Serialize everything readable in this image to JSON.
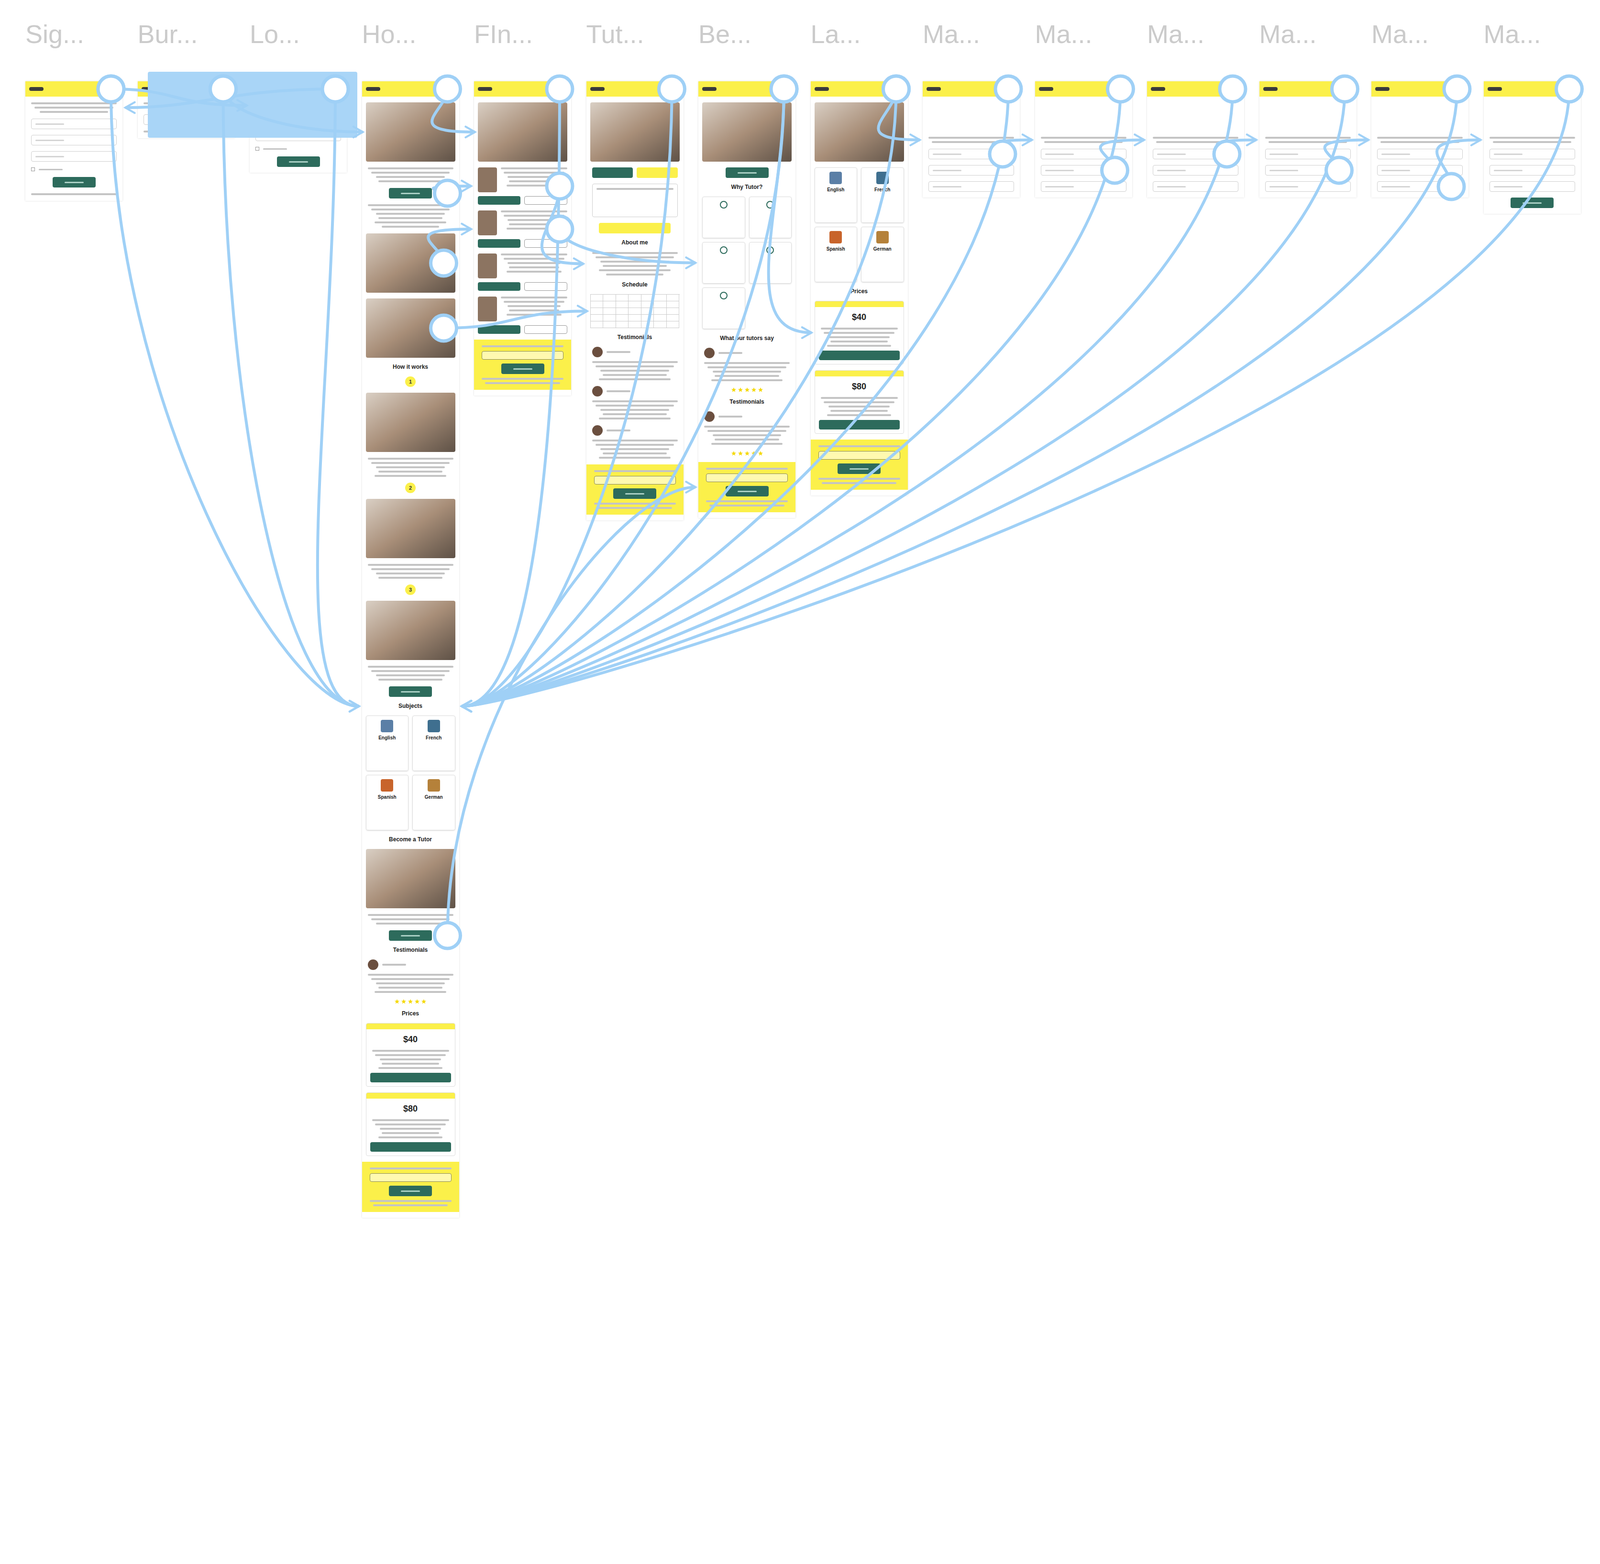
{
  "frames": [
    {
      "title": "Sig...",
      "sections": [
        {
          "kind": "header"
        },
        {
          "kind": "text",
          "lines": 3
        },
        {
          "kind": "field"
        },
        {
          "kind": "field"
        },
        {
          "kind": "field"
        },
        {
          "kind": "check"
        },
        {
          "kind": "button"
        },
        {
          "kind": "text",
          "lines": 1
        }
      ]
    },
    {
      "title": "Bur...",
      "sections": [
        {
          "kind": "header"
        },
        {
          "kind": "text",
          "lines": 2
        },
        {
          "kind": "field"
        },
        {
          "kind": "text",
          "lines": 1
        }
      ]
    },
    {
      "title": "Lo...",
      "sections": [
        {
          "kind": "header"
        },
        {
          "kind": "text",
          "lines": 2
        },
        {
          "kind": "field"
        },
        {
          "kind": "field"
        },
        {
          "kind": "check"
        },
        {
          "kind": "button"
        }
      ]
    },
    {
      "title": "Ho...",
      "sections": [
        {
          "kind": "header"
        },
        {
          "kind": "image"
        },
        {
          "kind": "text",
          "lines": 4
        },
        {
          "kind": "button"
        },
        {
          "kind": "text",
          "lines": 6
        },
        {
          "kind": "image"
        },
        {
          "kind": "image"
        },
        {
          "kind": "heading",
          "text": "How it works"
        },
        {
          "kind": "step",
          "text": "1"
        },
        {
          "kind": "image"
        },
        {
          "kind": "text",
          "lines": 5
        },
        {
          "kind": "step",
          "text": "2"
        },
        {
          "kind": "image"
        },
        {
          "kind": "text",
          "lines": 4
        },
        {
          "kind": "step",
          "text": "3"
        },
        {
          "kind": "image"
        },
        {
          "kind": "text",
          "lines": 4
        },
        {
          "kind": "button"
        },
        {
          "kind": "heading",
          "text": "Subjects"
        },
        {
          "kind": "cards",
          "items": [
            {
              "text": "English",
              "color": "#5b7fa6"
            },
            {
              "text": "French",
              "color": "#3f6f8f"
            },
            {
              "text": "Spanish",
              "color": "#c8642b"
            },
            {
              "text": "German",
              "color": "#b5813a"
            }
          ]
        },
        {
          "kind": "heading",
          "text": "Become a Tutor"
        },
        {
          "kind": "image"
        },
        {
          "kind": "text",
          "lines": 3
        },
        {
          "kind": "button"
        },
        {
          "kind": "heading",
          "text": "Testimonials"
        },
        {
          "kind": "testimonial"
        },
        {
          "kind": "stars",
          "stars": 5
        },
        {
          "kind": "heading",
          "text": "Prices"
        },
        {
          "kind": "price",
          "text": "$40"
        },
        {
          "kind": "price",
          "text": "$80"
        },
        {
          "kind": "newsletter"
        }
      ]
    },
    {
      "title": "FIn...",
      "sections": [
        {
          "kind": "header"
        },
        {
          "kind": "image"
        },
        {
          "kind": "tutor"
        },
        {
          "kind": "tutor"
        },
        {
          "kind": "tutor"
        },
        {
          "kind": "tutor"
        },
        {
          "kind": "newsletter"
        }
      ]
    },
    {
      "title": "Tut...",
      "sections": [
        {
          "kind": "header"
        },
        {
          "kind": "image"
        },
        {
          "kind": "button-pair"
        },
        {
          "kind": "textarea"
        },
        {
          "kind": "button-yellow"
        },
        {
          "kind": "heading",
          "text": "About me"
        },
        {
          "kind": "text",
          "lines": 6
        },
        {
          "kind": "heading",
          "text": "Schedule"
        },
        {
          "kind": "calendar"
        },
        {
          "kind": "heading",
          "text": "Testimonials"
        },
        {
          "kind": "testimonial"
        },
        {
          "kind": "testimonial"
        },
        {
          "kind": "testimonial"
        },
        {
          "kind": "newsletter"
        }
      ]
    },
    {
      "title": "Be...",
      "sections": [
        {
          "kind": "header"
        },
        {
          "kind": "image"
        },
        {
          "kind": "button"
        },
        {
          "kind": "heading",
          "text": "Why Tutor?"
        },
        {
          "kind": "features",
          "count": 5
        },
        {
          "kind": "heading",
          "text": "What our tutors say"
        },
        {
          "kind": "testimonial"
        },
        {
          "kind": "stars",
          "stars": 5
        },
        {
          "kind": "heading",
          "text": "Testimonials"
        },
        {
          "kind": "testimonial"
        },
        {
          "kind": "stars",
          "stars": 5
        },
        {
          "kind": "newsletter"
        }
      ]
    },
    {
      "title": "La...",
      "sections": [
        {
          "kind": "header"
        },
        {
          "kind": "image"
        },
        {
          "kind": "cards",
          "items": [
            {
              "text": "English",
              "color": "#5b7fa6"
            },
            {
              "text": "French",
              "color": "#3f6f8f"
            },
            {
              "text": "Spanish",
              "color": "#c8642b"
            },
            {
              "text": "German",
              "color": "#b5813a"
            }
          ]
        },
        {
          "kind": "heading",
          "text": "Prices"
        },
        {
          "kind": "price",
          "text": "$40"
        },
        {
          "kind": "price",
          "text": "$80"
        },
        {
          "kind": "newsletter"
        }
      ]
    },
    {
      "title": "Ma...",
      "sections": [
        {
          "kind": "header"
        },
        {
          "kind": "gap"
        },
        {
          "kind": "text",
          "lines": 2
        },
        {
          "kind": "field"
        },
        {
          "kind": "field"
        },
        {
          "kind": "field"
        }
      ]
    },
    {
      "title": "Ma...",
      "sections": [
        {
          "kind": "header"
        },
        {
          "kind": "gap"
        },
        {
          "kind": "text",
          "lines": 2
        },
        {
          "kind": "field"
        },
        {
          "kind": "field"
        },
        {
          "kind": "field"
        }
      ]
    },
    {
      "title": "Ma...",
      "sections": [
        {
          "kind": "header"
        },
        {
          "kind": "gap"
        },
        {
          "kind": "text",
          "lines": 2
        },
        {
          "kind": "field"
        },
        {
          "kind": "field"
        },
        {
          "kind": "field"
        }
      ]
    },
    {
      "title": "Ma...",
      "sections": [
        {
          "kind": "header"
        },
        {
          "kind": "gap"
        },
        {
          "kind": "text",
          "lines": 2
        },
        {
          "kind": "field"
        },
        {
          "kind": "field"
        },
        {
          "kind": "field"
        }
      ]
    },
    {
      "title": "Ma...",
      "sections": [
        {
          "kind": "header"
        },
        {
          "kind": "gap"
        },
        {
          "kind": "text",
          "lines": 2
        },
        {
          "kind": "field"
        },
        {
          "kind": "field"
        },
        {
          "kind": "field"
        }
      ]
    },
    {
      "title": "Ma...",
      "sections": [
        {
          "kind": "header"
        },
        {
          "kind": "gap"
        },
        {
          "kind": "text",
          "lines": 2
        },
        {
          "kind": "field"
        },
        {
          "kind": "field"
        },
        {
          "kind": "field"
        },
        {
          "kind": "button"
        }
      ]
    }
  ],
  "connections": [
    {
      "from": [
        0,
        0
      ],
      "to": [
        3,
        18
      ]
    },
    {
      "from": [
        1,
        0
      ],
      "to": [
        3,
        18
      ]
    },
    {
      "from": [
        2,
        0
      ],
      "to": [
        3,
        18
      ]
    },
    {
      "from": [
        4,
        0
      ],
      "to": [
        3,
        18
      ]
    },
    {
      "from": [
        5,
        0
      ],
      "to": [
        3,
        18
      ]
    },
    {
      "from": [
        6,
        0
      ],
      "to": [
        3,
        18
      ]
    },
    {
      "from": [
        7,
        0
      ],
      "to": [
        3,
        18
      ]
    },
    {
      "from": [
        8,
        0
      ],
      "to": [
        3,
        18
      ]
    },
    {
      "from": [
        9,
        0
      ],
      "to": [
        3,
        18
      ]
    },
    {
      "from": [
        10,
        0
      ],
      "to": [
        3,
        18
      ]
    },
    {
      "from": [
        11,
        0
      ],
      "to": [
        3,
        18
      ]
    },
    {
      "from": [
        12,
        0
      ],
      "to": [
        3,
        18
      ]
    },
    {
      "from": [
        13,
        0
      ],
      "to": [
        3,
        18
      ]
    },
    {
      "from": [
        0,
        0
      ],
      "to": [
        2,
        1
      ]
    },
    {
      "from": [
        2,
        0
      ],
      "to": [
        0,
        1
      ]
    },
    {
      "from": [
        1,
        0
      ],
      "to": [
        3,
        1
      ]
    },
    {
      "from": [
        3,
        0
      ],
      "to": [
        4,
        1
      ]
    },
    {
      "from": [
        3,
        3
      ],
      "to": [
        4,
        2
      ]
    },
    {
      "from": [
        3,
        5
      ],
      "to": [
        4,
        3
      ]
    },
    {
      "from": [
        3,
        6
      ],
      "to": [
        5,
        8
      ]
    },
    {
      "from": [
        4,
        2
      ],
      "to": [
        5,
        6
      ]
    },
    {
      "from": [
        4,
        3
      ],
      "to": [
        6,
        4
      ]
    },
    {
      "from": [
        3,
        23
      ],
      "to": [
        6,
        11
      ]
    },
    {
      "from": [
        6,
        0
      ],
      "to": [
        7,
        4
      ]
    },
    {
      "from": [
        7,
        0
      ],
      "to": [
        8,
        2
      ]
    },
    {
      "from": [
        8,
        3
      ],
      "to": [
        9,
        2
      ]
    },
    {
      "from": [
        9,
        4
      ],
      "to": [
        10,
        2
      ]
    },
    {
      "from": [
        10,
        3
      ],
      "to": [
        11,
        2
      ]
    },
    {
      "from": [
        11,
        4
      ],
      "to": [
        12,
        2
      ]
    },
    {
      "from": [
        12,
        5
      ],
      "to": [
        13,
        2
      ]
    }
  ]
}
